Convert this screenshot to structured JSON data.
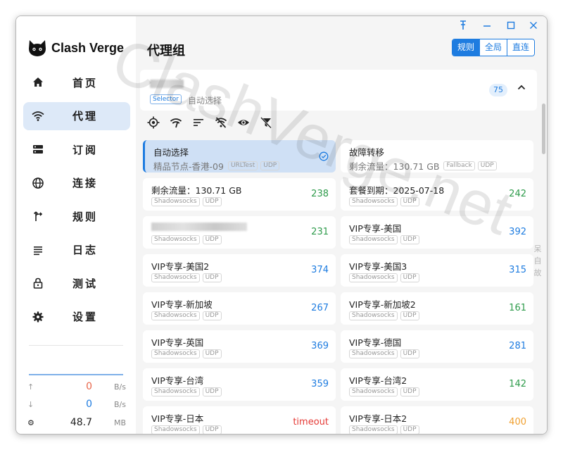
{
  "app": {
    "name": "Clash Verge",
    "watermark": "ClashVerge.net",
    "side_watermark": [
      "呆",
      "自",
      "故"
    ]
  },
  "sidebar": {
    "items": [
      {
        "label": "首页",
        "icon": "home-icon"
      },
      {
        "label": "代理",
        "icon": "wifi-icon",
        "active": true
      },
      {
        "label": "订阅",
        "icon": "server-icon"
      },
      {
        "label": "连接",
        "icon": "globe-icon"
      },
      {
        "label": "规则",
        "icon": "fork-icon"
      },
      {
        "label": "日志",
        "icon": "list-icon"
      },
      {
        "label": "测试",
        "icon": "lock-icon"
      },
      {
        "label": "设置",
        "icon": "gear-icon"
      }
    ],
    "traffic": {
      "upload": {
        "icon": "↑",
        "value": "0",
        "unit": "B/s",
        "color": "#e8664a"
      },
      "download": {
        "icon": "↓",
        "value": "0",
        "unit": "B/s",
        "color": "#1e7ce0"
      },
      "memory": {
        "icon": "⚙",
        "value": "48.7",
        "unit": "MB",
        "color": "#222222"
      }
    }
  },
  "header": {
    "title": "代理组",
    "modes": [
      {
        "label": "规则",
        "active": true
      },
      {
        "label": "全局",
        "active": false
      },
      {
        "label": "直连",
        "active": false
      }
    ]
  },
  "group": {
    "type": "Selector",
    "now": "自动选择",
    "count": "75"
  },
  "proxies": [
    {
      "name": "自动选择",
      "now": "精品节点-香港-09",
      "tags": [
        "URLTest",
        "UDP"
      ],
      "delay": "",
      "selected": true
    },
    {
      "name": "故障转移",
      "now": "剩余流量：130.71 GB",
      "tags": [
        "Fallback",
        "UDP"
      ],
      "delay": ""
    },
    {
      "name": "剩余流量：130.71 GB",
      "tags": [
        "Shadowsocks",
        "UDP"
      ],
      "delay": "238",
      "color": "#2e9b4b"
    },
    {
      "name": "套餐到期：2025-07-18",
      "tags": [
        "Shadowsocks",
        "UDP"
      ],
      "delay": "242",
      "color": "#2e9b4b"
    },
    {
      "name": "",
      "blurred": true,
      "tags": [
        "Shadowsocks",
        "UDP"
      ],
      "delay": "231",
      "color": "#2e9b4b"
    },
    {
      "name": "VIP专享-美国",
      "tags": [
        "Shadowsocks",
        "UDP"
      ],
      "delay": "392",
      "color": "#1e7ce0"
    },
    {
      "name": "VIP专享-美国2",
      "tags": [
        "Shadowsocks",
        "UDP"
      ],
      "delay": "374",
      "color": "#1e7ce0"
    },
    {
      "name": "VIP专享-美国3",
      "tags": [
        "Shadowsocks",
        "UDP"
      ],
      "delay": "315",
      "color": "#1e7ce0"
    },
    {
      "name": "VIP专享-新加坡",
      "tags": [
        "Shadowsocks",
        "UDP"
      ],
      "delay": "267",
      "color": "#1e7ce0"
    },
    {
      "name": "VIP专享-新加坡2",
      "tags": [
        "Shadowsocks",
        "UDP"
      ],
      "delay": "161",
      "color": "#2e9b4b"
    },
    {
      "name": "VIP专享-英国",
      "tags": [
        "Shadowsocks",
        "UDP"
      ],
      "delay": "369",
      "color": "#1e7ce0"
    },
    {
      "name": "VIP专享-德国",
      "tags": [
        "Shadowsocks",
        "UDP"
      ],
      "delay": "281",
      "color": "#1e7ce0"
    },
    {
      "name": "VIP专享-台湾",
      "tags": [
        "Shadowsocks",
        "UDP"
      ],
      "delay": "359",
      "color": "#1e7ce0"
    },
    {
      "name": "VIP专享-台湾2",
      "tags": [
        "Shadowsocks",
        "UDP"
      ],
      "delay": "142",
      "color": "#2e9b4b"
    },
    {
      "name": "VIP专享-日本",
      "tags": [
        "Shadowsocks",
        "UDP"
      ],
      "delay": "timeout",
      "color": "#e53935"
    },
    {
      "name": "VIP专享-日本2",
      "tags": [
        "Shadowsocks",
        "UDP"
      ],
      "delay": "400",
      "color": "#f0a030"
    }
  ]
}
